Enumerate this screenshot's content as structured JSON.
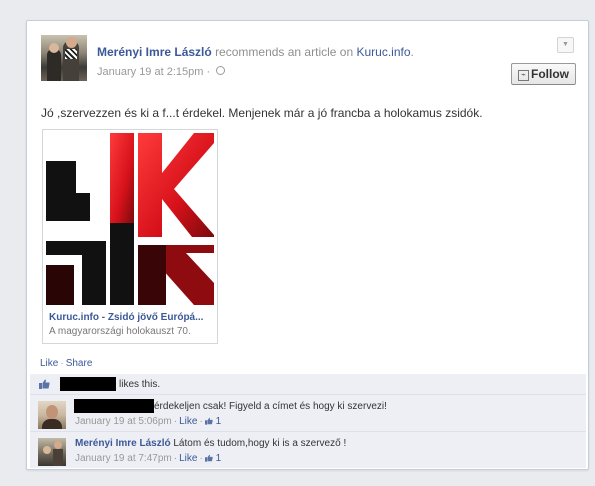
{
  "post": {
    "author": "Merényi Imre László",
    "action_text": "recommends an article on",
    "source_link": "Kuruc.info",
    "period": ".",
    "timestamp": "January 19 at 2:15pm",
    "time_separator": "·",
    "follow_label": "Follow",
    "follow_icon": "rss-icon",
    "menu_icon": "chevron-down-icon",
    "status_text": "Jó ,szervezzen és ki a f...t érdekel. Menjenek már a jó francba a holokamus zsidók.",
    "attachment": {
      "title": "Kuruc.info - Zsidó jövő Európá...",
      "description": "A magyarországi holokauszt 70."
    }
  },
  "actions": {
    "like": "Like",
    "separator": "·",
    "share": "Share"
  },
  "likes": {
    "text": "likes this."
  },
  "comments": [
    {
      "text": "érdekeljen csak! Figyeld a címet és hogy ki szervezi!",
      "timestamp": "January 19 at 5:06pm",
      "like_label": "Like",
      "like_count": "1"
    },
    {
      "author": "Merényi Imre László",
      "text": "Látom és tudom,hogy ki is a szervező !",
      "timestamp": "January 19 at 7:47pm",
      "like_label": "Like",
      "like_count": "1"
    }
  ],
  "colors": {
    "link": "#3b5998",
    "logo_red": "#e3141b",
    "logo_black": "#111111"
  }
}
